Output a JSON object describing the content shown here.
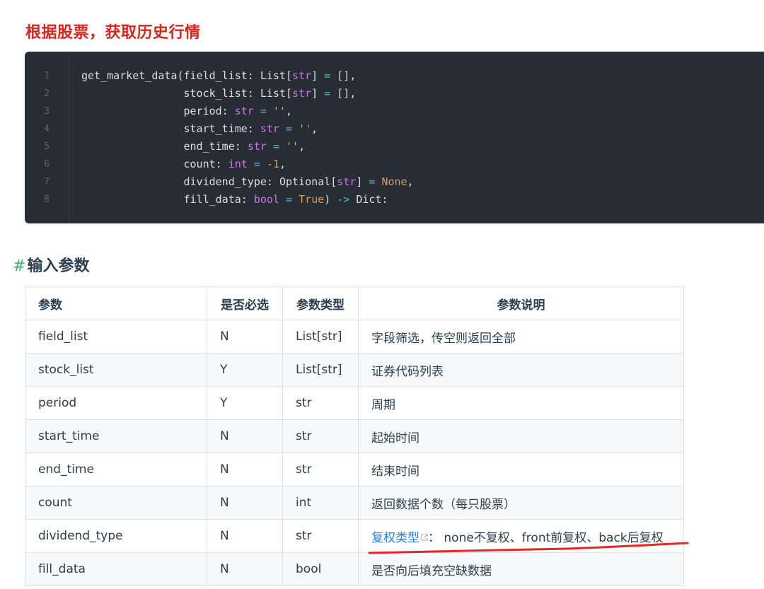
{
  "page_title": "根据股票，获取历史行情",
  "code": {
    "line_numbers": [
      "1",
      "2",
      "3",
      "4",
      "5",
      "6",
      "7",
      "8"
    ]
  },
  "section": {
    "hash": "#",
    "title": "输入参数"
  },
  "table": {
    "headers": [
      "参数",
      "是否必选",
      "参数类型",
      "参数说明"
    ],
    "rows": [
      {
        "param": "field_list",
        "required": "N",
        "type": "List[str]",
        "desc": "字段筛选，传空则返回全部"
      },
      {
        "param": "stock_list",
        "required": "Y",
        "type": "List[str]",
        "desc": "证券代码列表"
      },
      {
        "param": "period",
        "required": "Y",
        "type": "str",
        "desc": "周期"
      },
      {
        "param": "start_time",
        "required": "N",
        "type": "str",
        "desc": "起始时间"
      },
      {
        "param": "end_time",
        "required": "N",
        "type": "str",
        "desc": "结束时间"
      },
      {
        "param": "count",
        "required": "N",
        "type": "int",
        "desc": "返回数据个数（每只股票）"
      },
      {
        "param": "dividend_type",
        "required": "N",
        "type": "str",
        "desc_link": "复权类型",
        "desc": "： none不复权、front前复权、back后复权"
      },
      {
        "param": "fill_data",
        "required": "N",
        "type": "bool",
        "desc": "是否向后填充空缺数据"
      }
    ]
  },
  "colors": {
    "title_red": "#d9251c",
    "code_bg": "#282c34",
    "link_blue": "#2b7de9",
    "hash_green": "#3eaf7c",
    "annotation_red": "#e8262a"
  }
}
